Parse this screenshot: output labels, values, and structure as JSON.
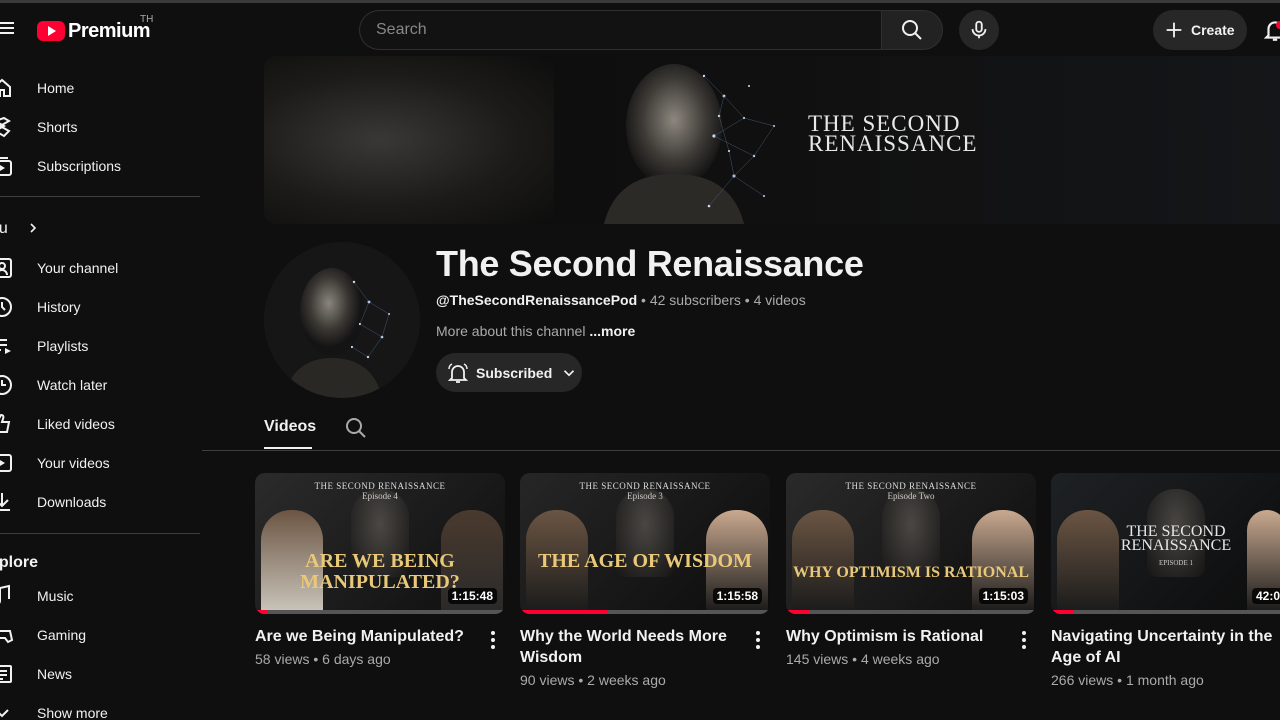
{
  "header": {
    "logo_text": "Premium",
    "country_code": "TH",
    "search_placeholder": "Search",
    "create_label": "Create"
  },
  "sidebar": {
    "main": [
      {
        "label": "Home",
        "icon": "home-icon"
      },
      {
        "label": "Shorts",
        "icon": "shorts-icon"
      },
      {
        "label": "Subscriptions",
        "icon": "subscriptions-icon"
      }
    ],
    "you_heading": "ou",
    "you": [
      {
        "label": "Your channel",
        "icon": "your-channel-icon"
      },
      {
        "label": "History",
        "icon": "history-icon"
      },
      {
        "label": "Playlists",
        "icon": "playlists-icon"
      },
      {
        "label": "Watch later",
        "icon": "watch-later-icon"
      },
      {
        "label": "Liked videos",
        "icon": "like-icon"
      },
      {
        "label": "Your videos",
        "icon": "your-videos-icon"
      },
      {
        "label": "Downloads",
        "icon": "download-icon"
      }
    ],
    "explore_heading": "xplore",
    "explore": [
      {
        "label": "Music",
        "icon": "music-icon"
      },
      {
        "label": "Gaming",
        "icon": "gaming-icon"
      },
      {
        "label": "News",
        "icon": "news-icon"
      },
      {
        "label": "Show more",
        "icon": "chevron-down-icon"
      }
    ]
  },
  "banner": {
    "line1": "THE SECOND",
    "line2": "RENAISSANCE"
  },
  "channel": {
    "title": "The Second Renaissance",
    "handle": "@TheSecondRenaissancePod",
    "subscribers": "42 subscribers",
    "videos_count": "4 videos",
    "about": "More about this channel",
    "more_label": "...more",
    "subscribe_label": "Subscribed"
  },
  "tabs": {
    "videos_label": "Videos"
  },
  "videos": [
    {
      "title": "Are we Being Manipulated?",
      "views": "58 views",
      "age": "6 days ago",
      "duration": "1:15:48",
      "progress": 0.05,
      "thumb_caption": "THE SECOND RENAISSANCE",
      "thumb_sub": "Episode 4",
      "thumb_big": "ARE WE BEING MANIPULATED?"
    },
    {
      "title": "Why the World Needs More Wisdom",
      "views": "90 views",
      "age": "2 weeks ago",
      "duration": "1:15:58",
      "progress": 0.35,
      "thumb_caption": "THE SECOND RENAISSANCE",
      "thumb_sub": "Episode 3",
      "thumb_big": "THE AGE OF WISDOM"
    },
    {
      "title": "Why Optimism is Rational",
      "views": "145 views",
      "age": "4 weeks ago",
      "duration": "1:15:03",
      "progress": 0.09,
      "thumb_caption": "THE SECOND RENAISSANCE",
      "thumb_sub": "Episode Two",
      "thumb_big": "WHY OPTIMISM IS RATIONAL"
    },
    {
      "title": "Navigating Uncertainty in the Age of AI",
      "views": "266 views",
      "age": "1 month ago",
      "duration": "42:0",
      "progress": 0.1,
      "thumb_caption": "",
      "thumb_sub": "EPISODE 1",
      "thumb_big": "THE SECOND RENAISSANCE"
    }
  ],
  "colors": {
    "background": "#0f0f0f",
    "accent": "#ff0033",
    "text_primary": "#f1f1f1",
    "text_secondary": "#aaaaaa",
    "thumb_gold": "#e9c979"
  }
}
